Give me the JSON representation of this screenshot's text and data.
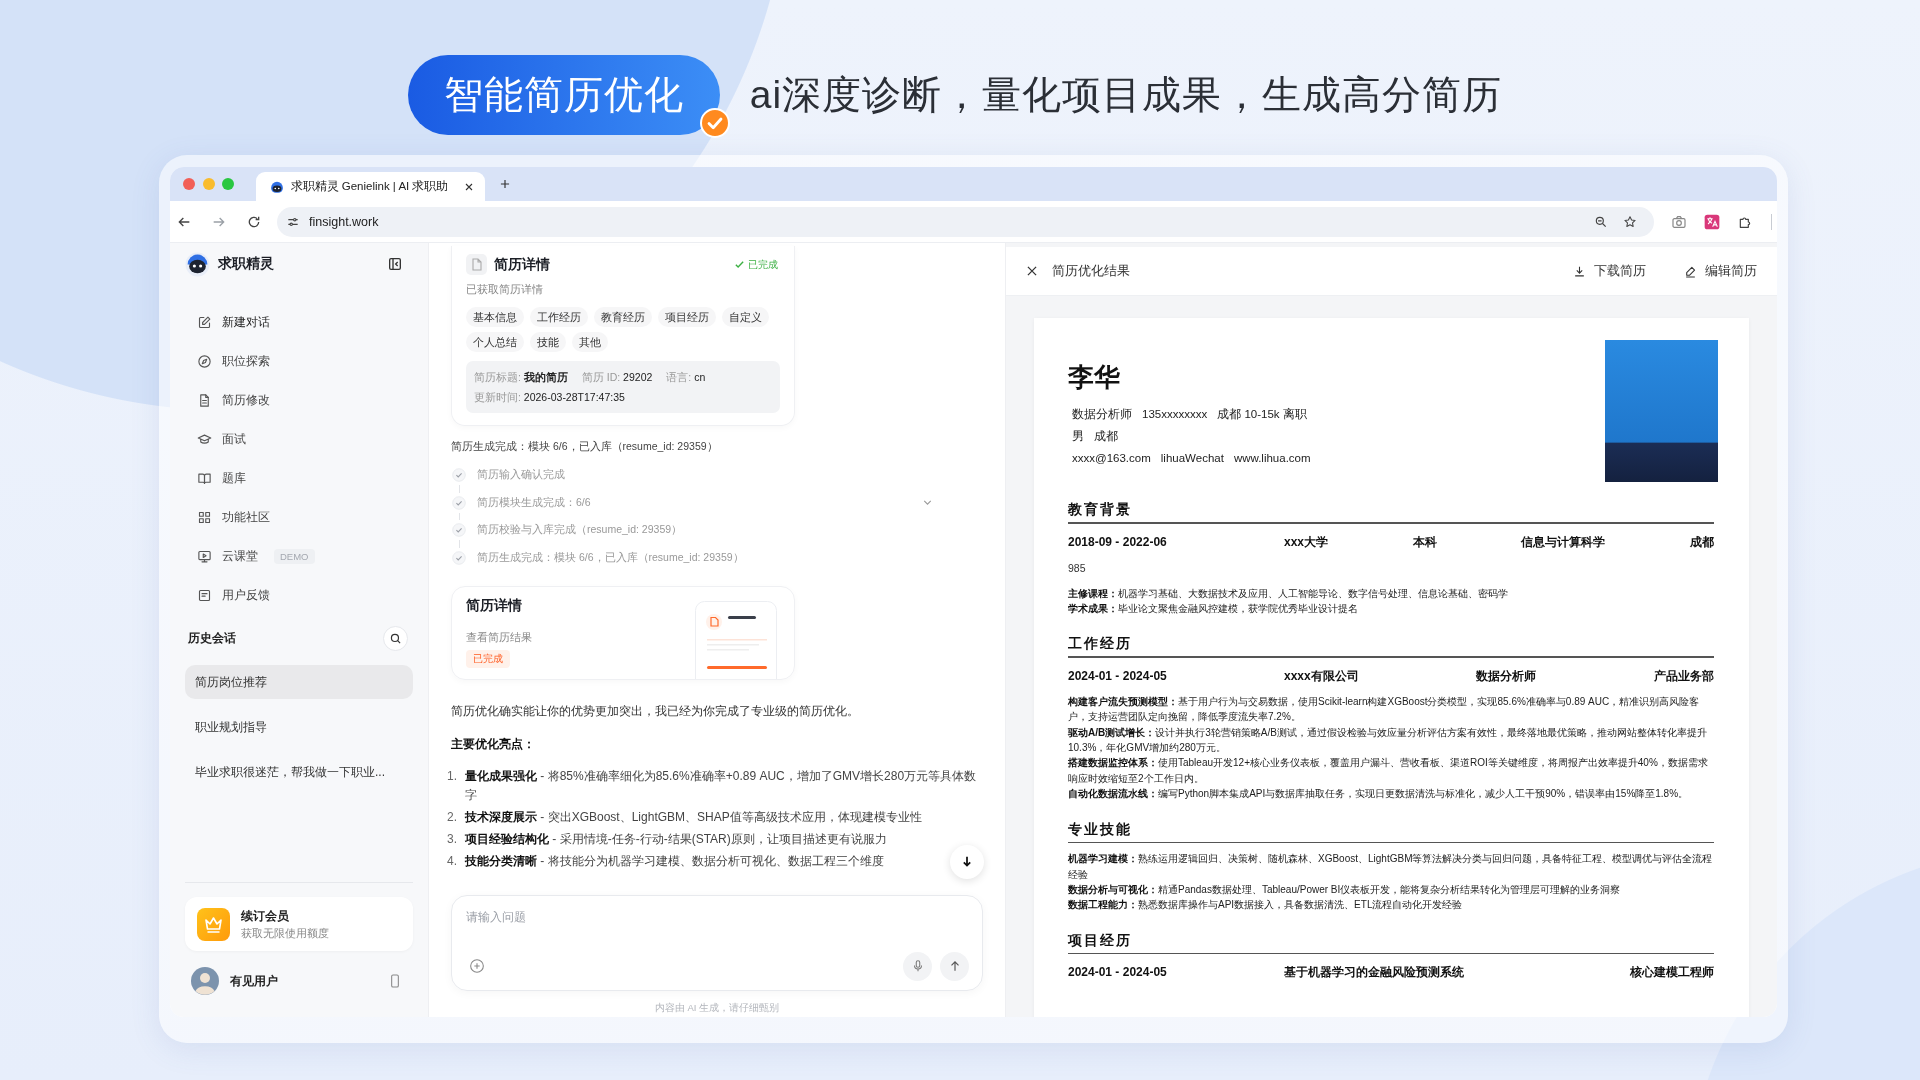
{
  "banner": {
    "badge": "智能简历优化",
    "tagline": "ai深度诊断，量化项目成果，生成高分简历"
  },
  "browser": {
    "tab_title": "求职精灵 Genielink | AI 求职助",
    "url": "finsight.work"
  },
  "sidebar": {
    "brand": "求职精灵",
    "nav": [
      {
        "label": "新建对话"
      },
      {
        "label": "职位探索"
      },
      {
        "label": "简历修改"
      },
      {
        "label": "面试"
      },
      {
        "label": "题库"
      },
      {
        "label": "功能社区"
      },
      {
        "label": "云课堂",
        "badge": "DEMO"
      },
      {
        "label": "用户反馈"
      }
    ],
    "history": {
      "title": "历史会话",
      "items": [
        {
          "label": "简历岗位推荐",
          "selected": true
        },
        {
          "label": "职业规划指导",
          "selected": false
        },
        {
          "label": "毕业求职很迷茫，帮我做一下职业...",
          "selected": false
        }
      ]
    },
    "membership": {
      "title": "续订会员",
      "subtitle": "获取无限使用额度"
    },
    "user": {
      "name": "有见用户"
    }
  },
  "chat": {
    "detail_card": {
      "title": "简历详情",
      "status": "已完成",
      "subtitle": "已获取简历详情",
      "tags": [
        "基本信息",
        "工作经历",
        "教育经历",
        "项目经历",
        "自定义",
        "个人总结",
        "技能",
        "其他"
      ],
      "meta": [
        [
          {
            "label": "简历标题:",
            "value": "我的简历"
          },
          {
            "label": "简历 ID:",
            "value": "29202"
          },
          {
            "label": "语言:",
            "value": "cn"
          }
        ],
        [
          {
            "label": "更新时间:",
            "value": "2026-03-28T17:47:35"
          }
        ]
      ]
    },
    "progress": {
      "summary": "简历生成完成：模块 6/6，已入库（resume_id: 29359）",
      "steps": [
        {
          "label": "简历输入确认完成",
          "done": true
        },
        {
          "label": "简历模块生成完成：6/6",
          "done": true
        },
        {
          "label": "简历校验与入库完成（resume_id: 29359）",
          "done": true
        },
        {
          "label": "简历生成完成：模块 6/6，已入库（resume_id: 29359）",
          "done": true
        }
      ]
    },
    "result_card": {
      "title": "简历详情",
      "subtitle": "查看简历结果",
      "status": "已完成"
    },
    "reply": {
      "intro": "简历优化确实能让你的优势更加突出，我已经为你完成了专业级的简历优化。",
      "heading": "主要优化亮点：",
      "highlights": [
        {
          "number": "1.",
          "text": "**量化成果强化** - 将85%准确率细化为85.6%准确率+0.89 AUC，增加了GMV增长280万元等具体数字"
        },
        {
          "number": "2.",
          "text": "**技术深度展示** - 突出XGBoost、LightGBM、SHAP值等高级技术应用，体现建模专业性"
        },
        {
          "number": "3.",
          "text": "**项目经验结构化** - 采用情境-任务-行动-结果(STAR)原则，让项目描述更有说服力"
        },
        {
          "number": "4.",
          "text": "**技能分类清晰** - 将技能分为机器学习建模、数据分析可视化、数据工程三个维度"
        }
      ]
    },
    "composer": {
      "placeholder": "请输入问题"
    },
    "disclaimer": "内容由 AI 生成，请仔细甄别"
  },
  "preview": {
    "title": "简历优化结果",
    "actions": [
      "下载简历",
      "编辑简历"
    ],
    "resume": {
      "name": "李华",
      "contact": [
        [
          "数据分析师",
          "135xxxxxxxx",
          "成都 10-15k 离职"
        ],
        [
          "男",
          "成都"
        ],
        [
          "xxxx@163.com",
          "lihuaWechat",
          "www.lihua.com"
        ]
      ],
      "sections": [
        {
          "heading": "教育背景",
          "entries": [
            {
              "fields": [
                "2018-09 - 2022-06",
                "xxx大学",
                "本科",
                "信息与计算科学",
                "成都"
              ],
              "note": "985",
              "lines": [
                "**主修课程：**机器学习基础、大数据技术及应用、人工智能导论、数字信号处理、信息论基础、密码学",
                "**学术成果：**毕业论文聚焦金融风控建模，获学院优秀毕业设计提名"
              ]
            }
          ]
        },
        {
          "heading": "工作经历",
          "entries": [
            {
              "fields": [
                "2024-01 - 2024-05",
                "xxxx有限公司",
                "数据分析师",
                "产品业务部"
              ],
              "lines": [
                "**构建客户流失预测模型：**基于用户行为与交易数据，使用Scikit-learn构建XGBoost分类模型，实现85.6%准确率与0.89 AUC，精准识别高风险客户，支持运营团队定向挽留，降低季度流失率7.2%。",
                "**驱动A/B测试增长：**设计并执行3轮营销策略A/B测试，通过假设检验与效应量分析评估方案有效性，最终落地最优策略，推动网站整体转化率提升10.3%，年化GMV增加约280万元。",
                "**搭建数据监控体系：**使用Tableau开发12+核心业务仪表板，覆盖用户漏斗、营收看板、渠道ROI等关键维度，将周报产出效率提升40%，数据需求响应时效缩短至2个工作日内。",
                "**自动化数据流水线：**编写Python脚本集成API与数据库抽取任务，实现日更数据清洗与标准化，减少人工干预90%，错误率由15%降至1.8%。"
              ]
            }
          ]
        },
        {
          "heading": "专业技能",
          "lines": [
            "**机器学习建模：**熟练运用逻辑回归、决策树、随机森林、XGBoost、LightGBM等算法解决分类与回归问题，具备特征工程、模型调优与评估全流程经验",
            "**数据分析与可视化：**精通Pandas数据处理、Tableau/Power BI仪表板开发，能将复杂分析结果转化为管理层可理解的业务洞察",
            "**数据工程能力：**熟悉数据库操作与API数据接入，具备数据清洗、ETL流程自动化开发经验"
          ]
        },
        {
          "heading": "项目经历",
          "entries": [
            {
              "fields": [
                "2024-01 - 2024-05",
                "基于机器学习的金融风险预测系统",
                "核心建模工程师"
              ]
            }
          ]
        }
      ]
    }
  }
}
